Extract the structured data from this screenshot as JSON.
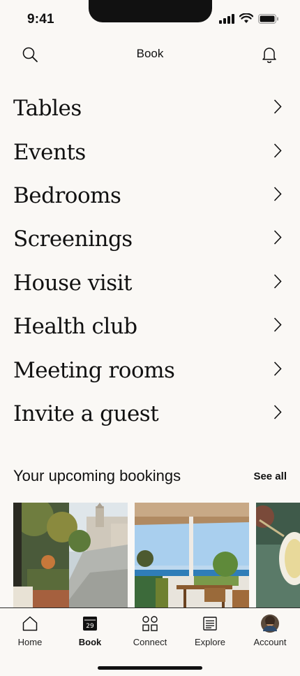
{
  "status": {
    "time": "9:41"
  },
  "header": {
    "title": "Book"
  },
  "menu": [
    {
      "label": "Tables"
    },
    {
      "label": "Events"
    },
    {
      "label": "Bedrooms"
    },
    {
      "label": "Screenings"
    },
    {
      "label": "House visit"
    },
    {
      "label": "Health club"
    },
    {
      "label": "Meeting rooms"
    },
    {
      "label": "Invite a guest"
    }
  ],
  "bookings": {
    "title": "Your upcoming bookings",
    "see_all": "See all"
  },
  "tabs": [
    {
      "label": "Home",
      "icon": "home-icon",
      "active": false
    },
    {
      "label": "Book",
      "icon": "calendar-icon",
      "active": true,
      "calendar_day": "29"
    },
    {
      "label": "Connect",
      "icon": "grid-icon",
      "active": false
    },
    {
      "label": "Explore",
      "icon": "newspaper-icon",
      "active": false
    },
    {
      "label": "Account",
      "icon": "avatar",
      "active": false
    }
  ],
  "colors": {
    "background": "#faf8f5",
    "text": "#111111"
  }
}
